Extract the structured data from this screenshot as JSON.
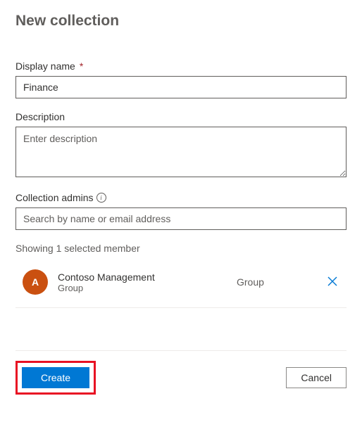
{
  "title": "New collection",
  "fields": {
    "display_name": {
      "label": "Display name",
      "required": "*",
      "value": "Finance"
    },
    "description": {
      "label": "Description",
      "placeholder": "Enter description",
      "value": ""
    },
    "admins": {
      "label": "Collection admins",
      "placeholder": "Search by name or email address",
      "value": ""
    }
  },
  "members_status": "Showing 1 selected member",
  "members": [
    {
      "initial": "A",
      "name": "Contoso Management",
      "sub": "Group",
      "type": "Group"
    }
  ],
  "buttons": {
    "create": "Create",
    "cancel": "Cancel"
  }
}
